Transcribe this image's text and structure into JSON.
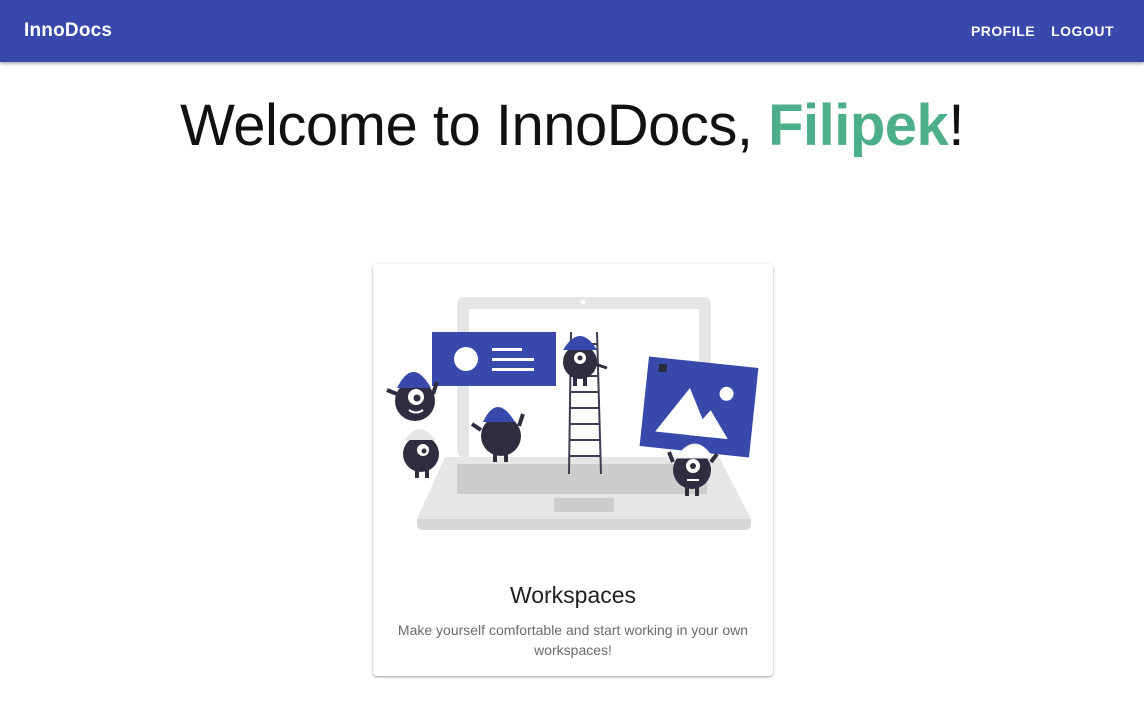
{
  "appbar": {
    "brand": "InnoDocs",
    "nav": [
      {
        "label": "PROFILE"
      },
      {
        "label": "LOGOUT"
      }
    ],
    "color": "#3949ab"
  },
  "welcome": {
    "prefix": "Welcome to InnoDocs, ",
    "user_name": "Filipek",
    "suffix": "!",
    "name_color": "#4caf8a"
  },
  "card": {
    "illustration": "team-building-website-illustration",
    "title": "Workspaces",
    "description": "Make yourself comfortable and start working in your own workspaces!"
  }
}
